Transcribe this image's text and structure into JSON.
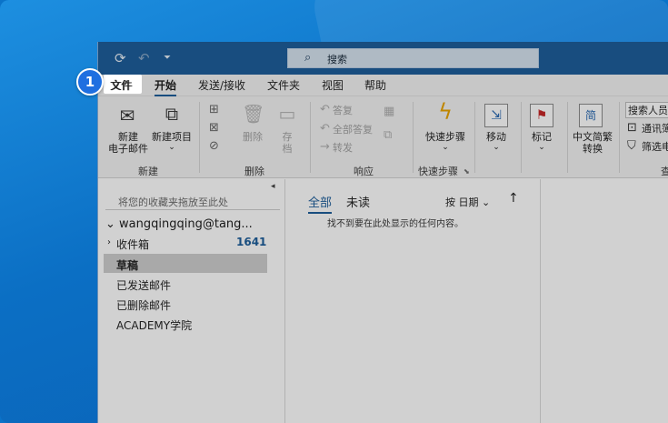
{
  "badge": "1",
  "search": {
    "label": "搜索"
  },
  "tabs": [
    "文件",
    "开始",
    "发送/接收",
    "文件夹",
    "视图",
    "帮助"
  ],
  "ribbon": {
    "new_email": [
      "新建",
      "电子邮件"
    ],
    "new_item": [
      "新建项目",
      "⌄"
    ],
    "delete": "删除",
    "archive": [
      "存",
      "档"
    ],
    "reply": "答复",
    "reply_all": "全部答复",
    "forward": "转发",
    "quick_steps": "快速步骤",
    "move": "移动",
    "tag": "标记",
    "chinese_conv": [
      "中文简繁",
      "转换"
    ],
    "search_people": "搜索人员",
    "address_book": "通讯簿",
    "filter_email": "筛选电",
    "groups": {
      "new": "新建",
      "delete": "删除",
      "respond": "响应",
      "quick_steps": "快速步骤",
      "find": "查"
    }
  },
  "folders": {
    "fav_hint": "将您的收藏夹拖放至此处",
    "account": "wangqingqing@tang...",
    "items": [
      "收件箱",
      "草稿",
      "已发送邮件",
      "已删除邮件",
      "ACADEMY学院"
    ],
    "inbox_unread": "1641"
  },
  "list": {
    "filter_all": "全部",
    "filter_unread": "未读",
    "sort": "按 日期",
    "empty": "找不到要在此处显示的任何内容。"
  }
}
